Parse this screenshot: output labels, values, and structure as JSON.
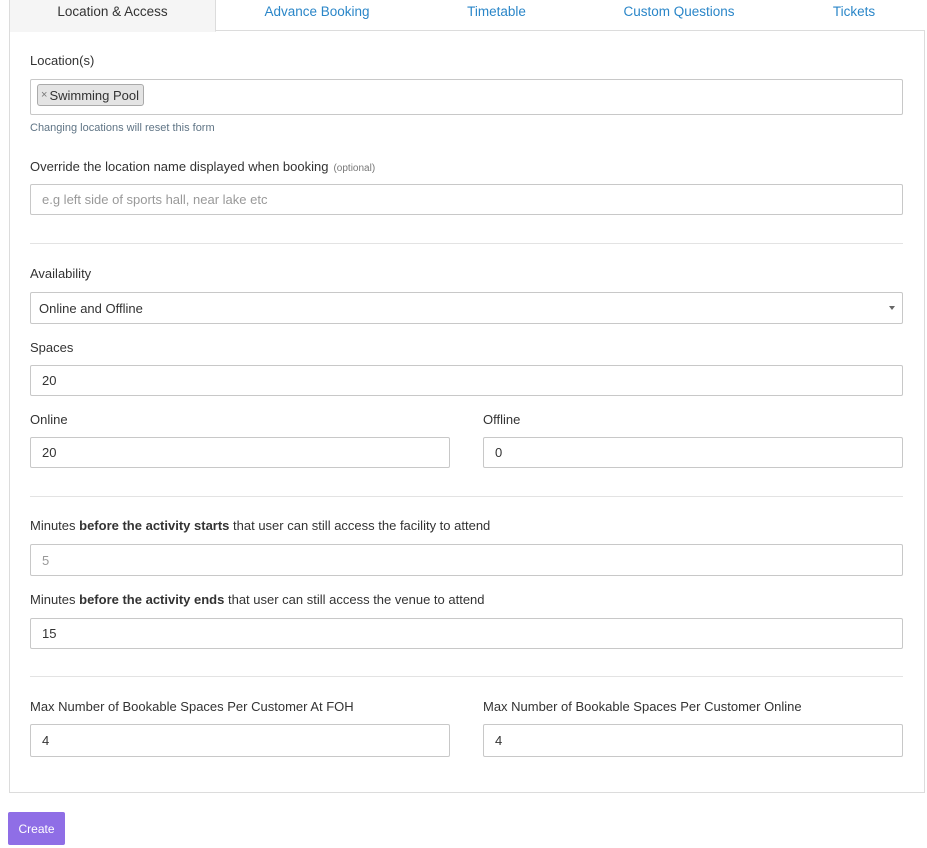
{
  "tabs": [
    {
      "label": "Location & Access",
      "active": true
    },
    {
      "label": "Advance Booking",
      "active": false
    },
    {
      "label": "Timetable",
      "active": false
    },
    {
      "label": "Custom Questions",
      "active": false
    },
    {
      "label": "Tickets",
      "active": false
    }
  ],
  "locations": {
    "label": "Location(s)",
    "tag_remove": "×",
    "selected": "Swimming Pool",
    "help": "Changing locations will reset this form"
  },
  "override": {
    "label": "Override the location name displayed when booking",
    "optional": "(optional)",
    "placeholder": "e.g left side of sports hall, near lake etc"
  },
  "availability": {
    "label": "Availability",
    "value": "Online and Offline"
  },
  "spaces": {
    "label": "Spaces",
    "value": "20",
    "online_label": "Online",
    "online_value": "20",
    "offline_label": "Offline",
    "offline_value": "0"
  },
  "access_before_start": {
    "label_prefix": "Minutes ",
    "label_bold": "before the activity starts",
    "label_suffix": " that user can still access the facility to attend",
    "value": "5"
  },
  "access_before_end": {
    "label_prefix": "Minutes ",
    "label_bold": "before the activity ends",
    "label_suffix": " that user can still access the venue to attend",
    "value": "15"
  },
  "max_spaces": {
    "foh_label": "Max Number of Bookable Spaces Per Customer At FOH",
    "foh_value": "4",
    "online_label": "Max Number of Bookable Spaces Per Customer Online",
    "online_value": "4"
  },
  "create_label": "Create",
  "colors": {
    "link": "#2a86c8",
    "primary_button": "#8f6ee6",
    "border": "#c8c8c8"
  }
}
